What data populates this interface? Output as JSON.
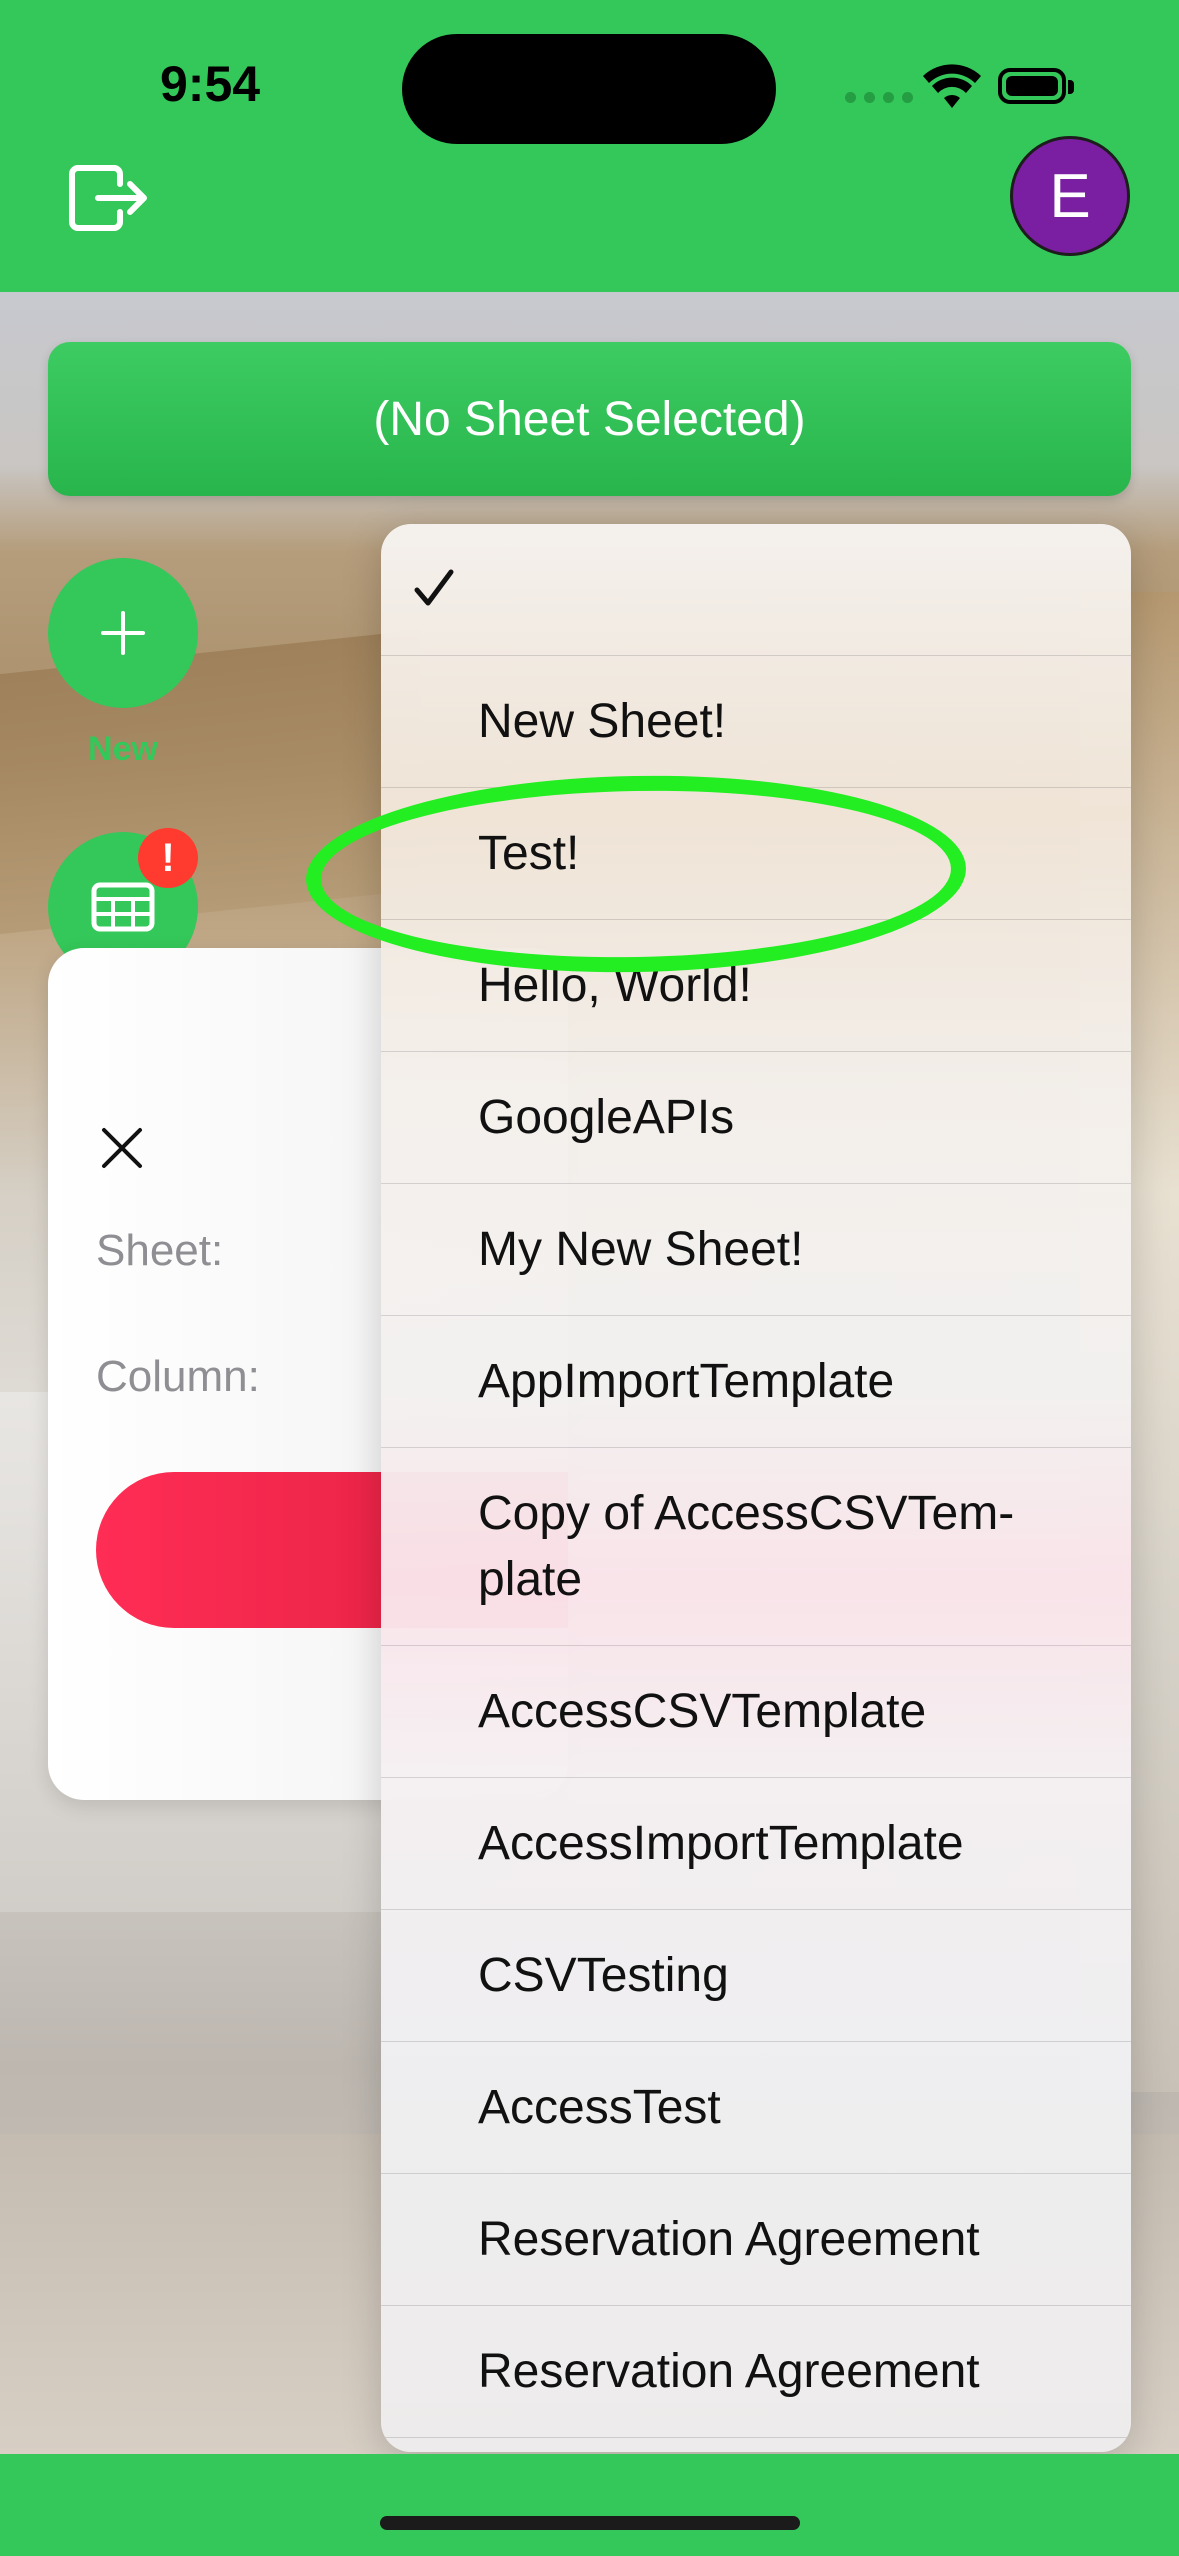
{
  "status_bar": {
    "time": "9:54"
  },
  "header": {
    "avatar_letter": "E",
    "icons": [
      "logout-icon"
    ]
  },
  "sheet_selector": {
    "label": "(No Sheet Selected)"
  },
  "fab": {
    "new_label": "New",
    "badge_text": "!",
    "icons": [
      "plus-icon",
      "table-icon"
    ]
  },
  "card": {
    "sheet_label": "Sheet:",
    "column_label": "Column:"
  },
  "menu": {
    "checked_item": "",
    "items": [
      {
        "label": ""
      },
      {
        "label": "New Sheet!"
      },
      {
        "label": "Test!"
      },
      {
        "label": "Hello, World!"
      },
      {
        "label": "GoogleAPIs"
      },
      {
        "label": "My New Sheet!"
      },
      {
        "label": "AppImportTemplate"
      },
      {
        "label": "Copy of AccessCSVTem-\nplate"
      },
      {
        "label": "AccessCSVTemplate"
      },
      {
        "label": "AccessImportTemplate"
      },
      {
        "label": "CSVTesting"
      },
      {
        "label": "AccessTest"
      },
      {
        "label": "Reservation Agreement"
      },
      {
        "label": "Reservation Agreement"
      }
    ]
  },
  "colors": {
    "brand_green": "#34c759",
    "avatar_purple": "#7b1fa2",
    "highlight_ring": "#22ee22",
    "alert_red": "#ff3b30"
  }
}
